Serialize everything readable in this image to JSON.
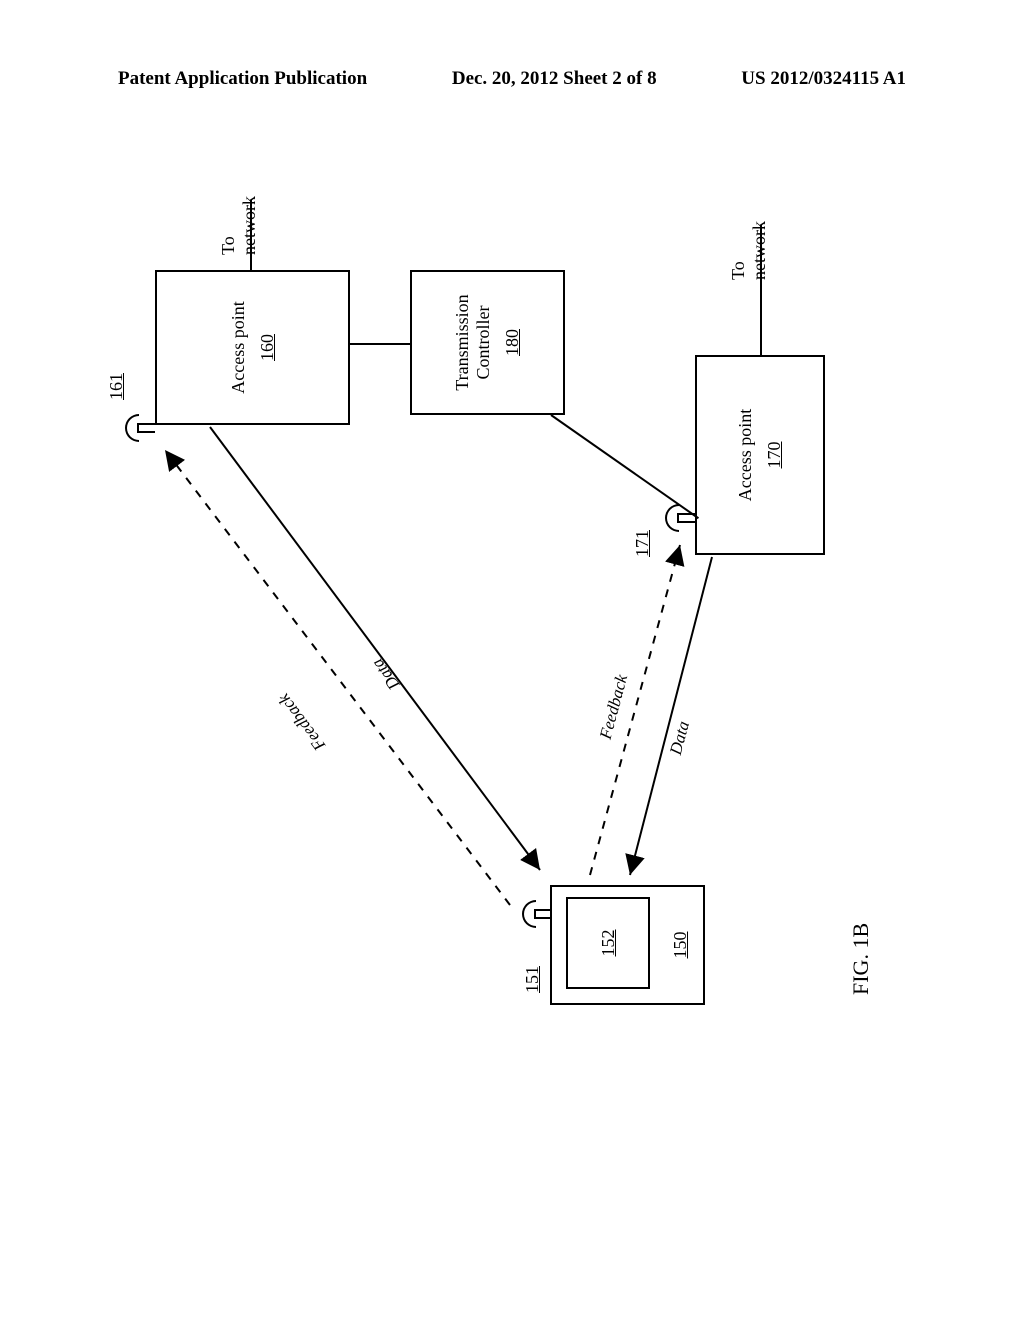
{
  "header": {
    "left": "Patent Application Publication",
    "center": "Dec. 20, 2012  Sheet 2 of 8",
    "right": "US 2012/0324115 A1"
  },
  "device": {
    "antenna_ref": "151",
    "inner_ref": "152",
    "ref": "150"
  },
  "ap160": {
    "title": "Access point",
    "ref": "160",
    "antenna_ref": "161",
    "net_label": "To network"
  },
  "ap170": {
    "title": "Access point",
    "ref": "170",
    "antenna_ref": "171",
    "net_label": "To network"
  },
  "tc180": {
    "title_line1": "Transmission",
    "title_line2": "Controller",
    "ref": "180"
  },
  "links": {
    "dev_ap160_feedback": "Feedback",
    "dev_ap160_data": "Data",
    "dev_ap170_feedback": "Feedback",
    "dev_ap170_data": "Data"
  },
  "figure_label": "FIG. 1B"
}
